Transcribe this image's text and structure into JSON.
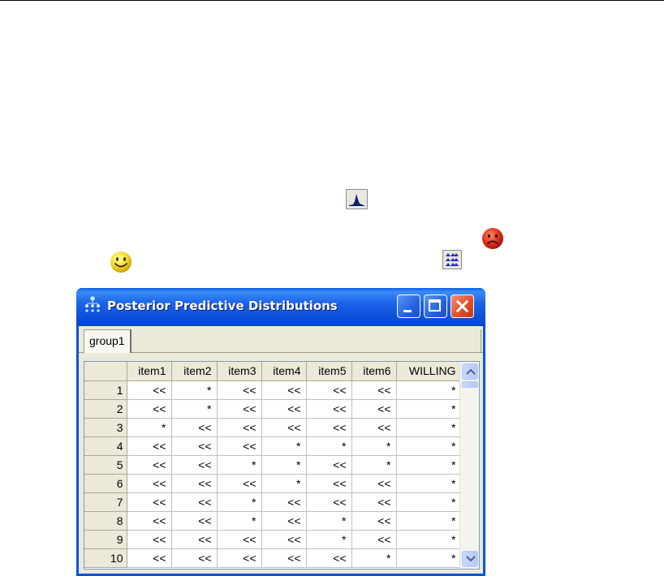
{
  "window": {
    "title": "Posterior Predictive Distributions",
    "title_icon": "network-tree-icon"
  },
  "tabs": [
    {
      "label": "group1",
      "selected": true
    }
  ],
  "grid": {
    "columns": [
      "",
      "item1",
      "item2",
      "item3",
      "item4",
      "item5",
      "item6",
      "WILLING"
    ],
    "rows": [
      {
        "index": "1",
        "cells": [
          "<<",
          "*",
          "<<",
          "<<",
          "<<",
          "<<",
          "*"
        ]
      },
      {
        "index": "2",
        "cells": [
          "<<",
          "*",
          "<<",
          "<<",
          "<<",
          "<<",
          "*"
        ]
      },
      {
        "index": "3",
        "cells": [
          "*",
          "<<",
          "<<",
          "<<",
          "<<",
          "<<",
          "*"
        ]
      },
      {
        "index": "4",
        "cells": [
          "<<",
          "<<",
          "<<",
          "*",
          "*",
          "*",
          "*"
        ]
      },
      {
        "index": "5",
        "cells": [
          "<<",
          "<<",
          "*",
          "*",
          "<<",
          "*",
          "*"
        ]
      },
      {
        "index": "6",
        "cells": [
          "<<",
          "<<",
          "<<",
          "*",
          "<<",
          "<<",
          "*"
        ]
      },
      {
        "index": "7",
        "cells": [
          "<<",
          "<<",
          "*",
          "<<",
          "<<",
          "<<",
          "*"
        ]
      },
      {
        "index": "8",
        "cells": [
          "<<",
          "<<",
          "*",
          "<<",
          "*",
          "<<",
          "*"
        ]
      },
      {
        "index": "9",
        "cells": [
          "<<",
          "<<",
          "<<",
          "<<",
          "*",
          "<<",
          "*"
        ]
      },
      {
        "index": "10",
        "cells": [
          "<<",
          "<<",
          "<<",
          "<<",
          "<<",
          "*",
          "*"
        ]
      }
    ]
  },
  "doc_icons": {
    "posterior_button": "posterior-density-icon",
    "sad_face": "frown-face-icon",
    "smile_face": "smiley-face-icon",
    "ppd_button": "posterior-predictive-icon"
  },
  "colors": {
    "titlebar": "#0a4fd8",
    "client": "#ece9d8",
    "sad_face": "#d42b1c",
    "smile_face": "#f6e14a"
  }
}
